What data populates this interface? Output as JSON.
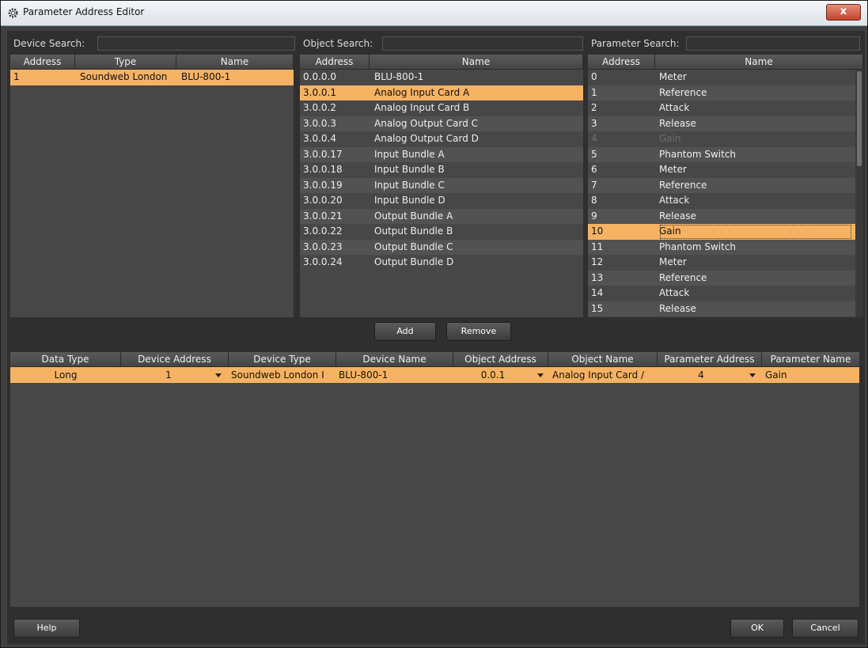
{
  "window": {
    "title": "Parameter Address Editor",
    "close_label": "x"
  },
  "device_search": {
    "label": "Device Search:",
    "value": "",
    "columns": [
      "Address",
      "Type",
      "Name"
    ],
    "rows": [
      {
        "address": "1",
        "type": "Soundweb London",
        "name": "BLU-800-1",
        "selected": true
      }
    ]
  },
  "object_search": {
    "label": "Object Search:",
    "value": "",
    "columns": [
      "Address",
      "Name"
    ],
    "rows": [
      {
        "address": "0.0.0.0",
        "name": "BLU-800-1"
      },
      {
        "address": "3.0.0.1",
        "name": "Analog Input Card A",
        "selected": true
      },
      {
        "address": "3.0.0.2",
        "name": "Analog Input Card B"
      },
      {
        "address": "3.0.0.3",
        "name": "Analog Output Card C"
      },
      {
        "address": "3.0.0.4",
        "name": "Analog Output Card D"
      },
      {
        "address": "3.0.0.17",
        "name": "Input Bundle A"
      },
      {
        "address": "3.0.0.18",
        "name": "Input Bundle B"
      },
      {
        "address": "3.0.0.19",
        "name": "Input Bundle C"
      },
      {
        "address": "3.0.0.20",
        "name": "Input Bundle D"
      },
      {
        "address": "3.0.0.21",
        "name": "Output Bundle A"
      },
      {
        "address": "3.0.0.22",
        "name": "Output Bundle B"
      },
      {
        "address": "3.0.0.23",
        "name": "Output Bundle C"
      },
      {
        "address": "3.0.0.24",
        "name": "Output Bundle D"
      }
    ]
  },
  "parameter_search": {
    "label": "Parameter Search:",
    "value": "",
    "columns": [
      "Address",
      "Name"
    ],
    "rows": [
      {
        "address": "0",
        "name": "Meter"
      },
      {
        "address": "1",
        "name": "Reference"
      },
      {
        "address": "2",
        "name": "Attack"
      },
      {
        "address": "3",
        "name": "Release"
      },
      {
        "address": "4",
        "name": "Gain",
        "disabled": true
      },
      {
        "address": "5",
        "name": "Phantom Switch"
      },
      {
        "address": "6",
        "name": "Meter"
      },
      {
        "address": "7",
        "name": "Reference"
      },
      {
        "address": "8",
        "name": "Attack"
      },
      {
        "address": "9",
        "name": "Release"
      },
      {
        "address": "10",
        "name": "Gain",
        "selected": true
      },
      {
        "address": "11",
        "name": "Phantom Switch"
      },
      {
        "address": "12",
        "name": "Meter"
      },
      {
        "address": "13",
        "name": "Reference"
      },
      {
        "address": "14",
        "name": "Attack"
      },
      {
        "address": "15",
        "name": "Release"
      }
    ]
  },
  "actions": {
    "add_label": "Add",
    "remove_label": "Remove"
  },
  "mapping_table": {
    "columns": [
      "Data Type",
      "Device Address",
      "Device Type",
      "Device Name",
      "Object Address",
      "Object Name",
      "Parameter Address",
      "Parameter Name"
    ],
    "rows": [
      {
        "data_type": "Long",
        "device_address": "1",
        "device_type": "Soundweb London I",
        "device_name": "BLU-800-1",
        "object_address": "0.0.1",
        "object_name": "Analog Input Card /",
        "parameter_address": "4",
        "parameter_name": "Gain",
        "selected": true
      }
    ]
  },
  "footer": {
    "help_label": "Help",
    "ok_label": "OK",
    "cancel_label": "Cancel"
  },
  "colors": {
    "selection": "#f6b263",
    "background": "#474747",
    "alt_row": "#525252"
  }
}
